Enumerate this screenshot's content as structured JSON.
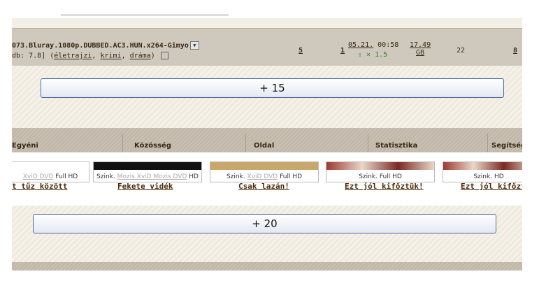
{
  "torrent": {
    "name": "073.Bluray.1080p.DUBBED.AC3.HUN.x264-Gimyo",
    "imdb_prefix": "db: 7.8]",
    "genres": [
      "életrajzi",
      "krimi",
      "dráma"
    ],
    "files": "5",
    "comments": "1",
    "date": "05.21.",
    "time": "00:58",
    "ratio": "× 1.5",
    "size_value": "17.49",
    "size_unit": "GB",
    "seeders": "22",
    "leechers": "8"
  },
  "more_top": {
    "label": "+ 15"
  },
  "nav": {
    "items": [
      "Egyéni",
      "Közösség",
      "Oldal",
      "Statisztika",
      "Segítség"
    ]
  },
  "movies": [
    {
      "tags_gray": "XviD DVD",
      "tags": "Full HD",
      "title": "t tűz között"
    },
    {
      "tags_prefix": "Szink.",
      "tags_gray": "Mozis XviD Mozis DVD",
      "tags": "HD",
      "title": "Fekete vidék"
    },
    {
      "tags_prefix": "Szink.",
      "tags_gray": "XviD DVD",
      "tags": "Full HD",
      "title": "Csak lazán!"
    },
    {
      "tags_prefix": "Szink.",
      "tags_gray": "",
      "tags": "Full HD",
      "title": "Ezt jól kifőztük!"
    },
    {
      "tags_prefix": "Szink.",
      "tags_gray": "",
      "tags": "HD",
      "title": "Ezt jól kifőztük"
    }
  ],
  "more_bottom": {
    "label": "+ 20"
  },
  "colors": {
    "accent_border": "#4a6aa8",
    "link": "#3a2a14",
    "up_arrow": "#2c8a2c"
  }
}
